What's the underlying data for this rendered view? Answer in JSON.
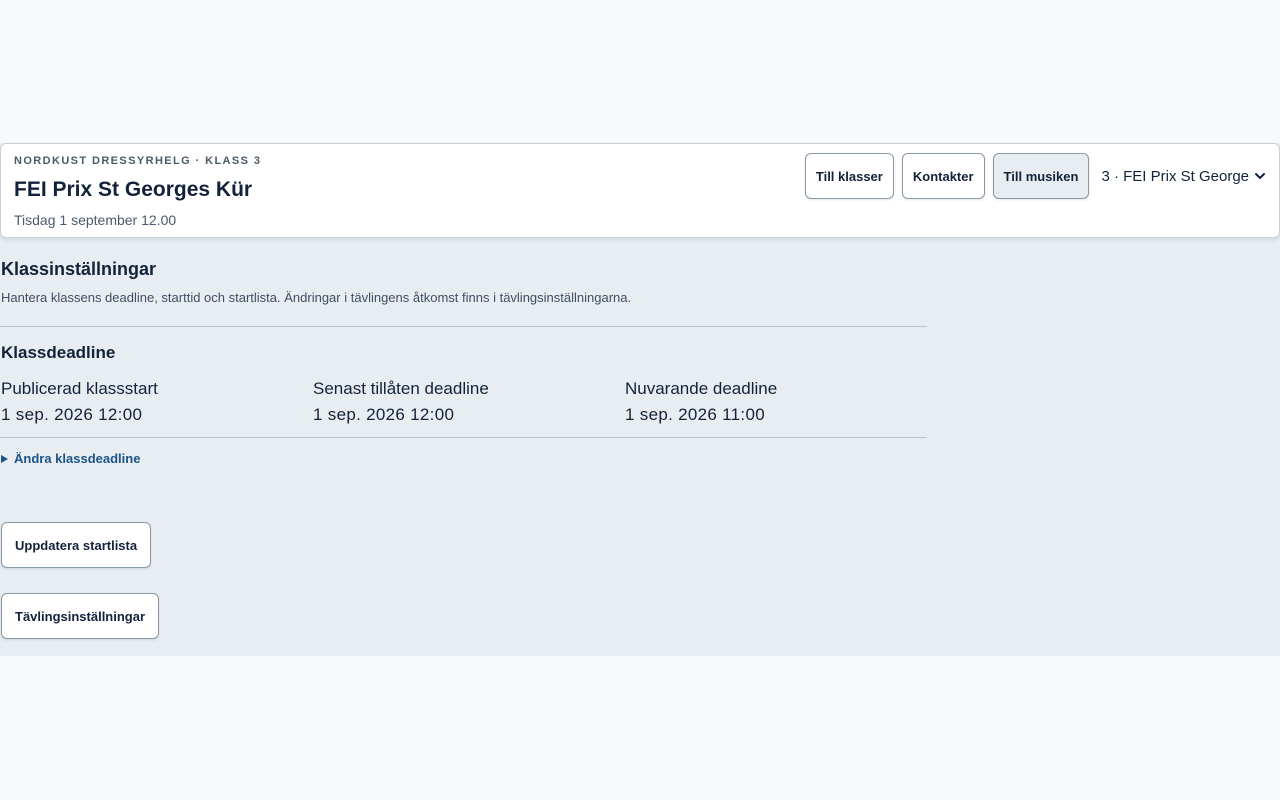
{
  "header": {
    "eyebrow": "NORDKUST DRESSYRHELG · KLASS 3",
    "title": "FEI Prix St Georges Kür",
    "date": "Tisdag 1 september 12.00",
    "buttons": {
      "classes": "Till klasser",
      "contacts": "Kontakter",
      "music": "Till musiken"
    },
    "class_select": {
      "value": "3 · FEI Prix St George",
      "icon": "chevron-down-icon"
    }
  },
  "settings": {
    "title": "Klassinställningar",
    "description": "Hantera klassens deadline, starttid och startlista. Ändringar i tävlingens åtkomst finns i tävlingsinställningarna."
  },
  "deadline": {
    "title": "Klassdeadline",
    "fields": [
      {
        "label": "Publicerad klassstart",
        "value": "1 sep. 2026 12:00"
      },
      {
        "label": "Senast tillåten deadline",
        "value": "1 sep. 2026 12:00"
      },
      {
        "label": "Nuvarande deadline",
        "value": "1 sep. 2026 11:00"
      }
    ],
    "change_link": "Ändra klassdeadline"
  },
  "actions": {
    "update_startlist": "Uppdatera startlista",
    "competition_settings": "Tävlingsinställningar"
  },
  "colors": {
    "page_bg": "#f7f9fc",
    "panel_bg": "#e8edf2",
    "text": "#13223a",
    "link": "#1a5489"
  }
}
